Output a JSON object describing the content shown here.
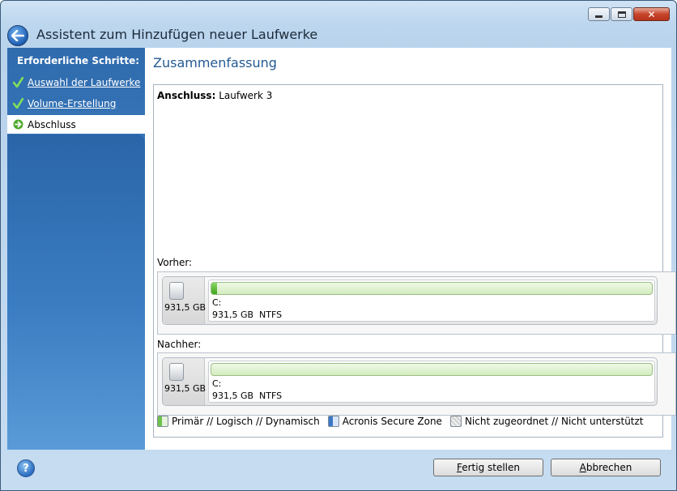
{
  "window": {
    "title": "Assistent zum Hinzufügen neuer Laufwerke",
    "caption_buttons": {
      "minimize": "–",
      "maximize": "□",
      "close": "✕"
    }
  },
  "sidebar": {
    "heading": "Erforderliche Schritte:",
    "steps": [
      {
        "label": "Auswahl der Laufwerke",
        "state": "done",
        "icon": "check-icon"
      },
      {
        "label": "Volume-Erstellung",
        "state": "done",
        "icon": "check-icon"
      },
      {
        "label": "Abschluss",
        "state": "current",
        "icon": "arrow-right-icon"
      }
    ]
  },
  "main": {
    "title": "Zusammenfassung",
    "summary_label": "Anschluss:",
    "summary_value": "Laufwerk 3",
    "before_label": "Vorher:",
    "after_label": "Nachher:",
    "before_disk": {
      "size": "931,5 GB",
      "partition_name": "C:",
      "partition_info": "931,5 GB  NTFS",
      "used_fraction": 0.012
    },
    "after_disk": {
      "size": "931,5 GB",
      "partition_name": "C:",
      "partition_info": "931,5 GB  NTFS",
      "used_fraction": 0.0
    },
    "legend": {
      "primary": "Primär // Logisch // Dynamisch",
      "acronis": "Acronis Secure Zone",
      "unallocated": "Nicht zugeordnet // Nicht unterstützt"
    }
  },
  "footer": {
    "finish_button": {
      "mnemonic": "F",
      "rest": "ertig stellen"
    },
    "cancel_button": {
      "mnemonic": "A",
      "rest": "bbrechen"
    }
  },
  "colors": {
    "sidebar_blue": "#3b7cc0",
    "title_blue": "#245a92",
    "partition_green": "#6cc24a"
  }
}
